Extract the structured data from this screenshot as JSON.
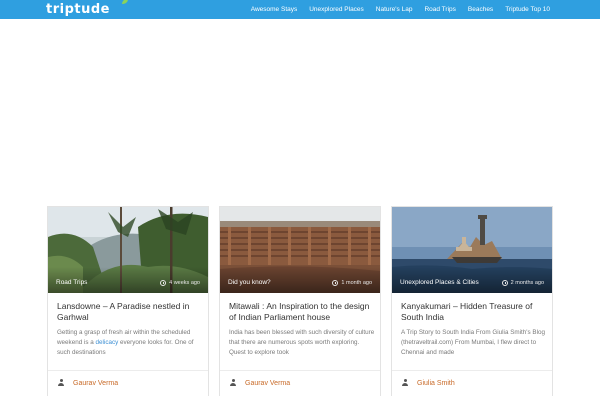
{
  "header": {
    "logo_text": "triptude",
    "brand_color": "#2f9fe0",
    "menu": [
      {
        "label": "Awesome Stays"
      },
      {
        "label": "Unexplored Places"
      },
      {
        "label": "Nature's Lap"
      },
      {
        "label": "Road Trips"
      },
      {
        "label": "Beaches"
      },
      {
        "label": "Triptude Top 10"
      }
    ]
  },
  "cards": [
    {
      "category": "Road Trips",
      "time": "4 weeks ago",
      "title": "Lansdowne – A Paradise nestled in Garhwal",
      "excerpt_before": "Getting a grasp of fresh air within the scheduled weekend is a ",
      "excerpt_link": "delicacy",
      "excerpt_after": " everyone looks for. One of such destinations",
      "author": "Gaurav Verma"
    },
    {
      "category": "Did you know?",
      "time": "1 month ago",
      "title": "Mitawali : An Inspiration to the design of Indian Parliament house",
      "excerpt": "India has been blessed with such diversity of culture that there are numerous spots worth exploring. Quest to explore took",
      "author": "Gaurav Verma"
    },
    {
      "category": "Unexplored Places & Cities",
      "time": "2 months ago",
      "title": "Kanyakumari – Hidden Treasure of South India",
      "excerpt": "A Trip Story to South India From Giulia Smith's Blog (thetraveltrail.com) From Mumbai, I flew direct to Chennai and made",
      "author": "Giulia Smith"
    }
  ],
  "colors": {
    "author_link": "#c86a28",
    "inline_link": "#3b8fd4"
  }
}
